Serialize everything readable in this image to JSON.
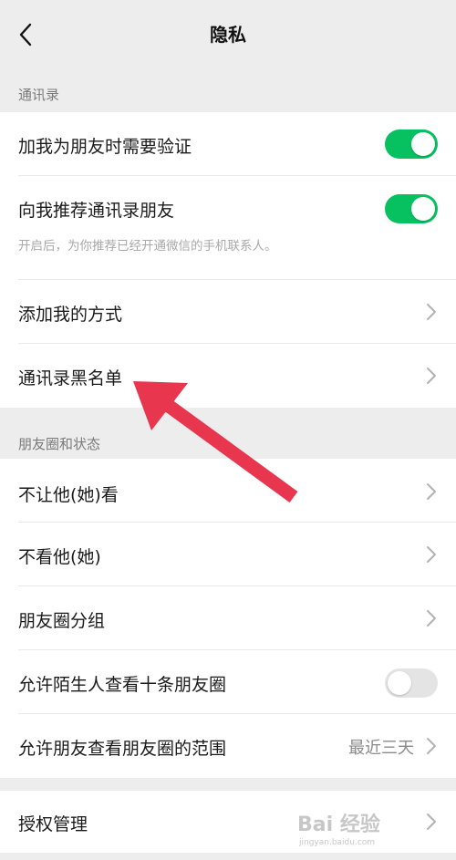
{
  "header": {
    "title": "隐私",
    "back_icon": "chevron-left-icon"
  },
  "contacts_section": {
    "label": "通讯录",
    "items": [
      {
        "label": "加我为朋友时需要验证",
        "control": "toggle",
        "on": true
      },
      {
        "label": "向我推荐通讯录朋友",
        "subtext": "开启后，为你推荐已经开通微信的手机联系人。",
        "control": "toggle",
        "on": true
      },
      {
        "label": "添加我的方式",
        "control": "chevron"
      },
      {
        "label": "通讯录黑名单",
        "control": "chevron"
      }
    ]
  },
  "moments_section": {
    "label": "朋友圈和状态",
    "items": [
      {
        "label": "不让他(她)看",
        "control": "chevron"
      },
      {
        "label": "不看他(她)",
        "control": "chevron"
      },
      {
        "label": "朋友圈分组",
        "control": "chevron"
      },
      {
        "label": "允许陌生人查看十条朋友圈",
        "control": "toggle",
        "on": false
      },
      {
        "label": "允许朋友查看朋友圈的范围",
        "value": "最近三天",
        "control": "chevron"
      }
    ]
  },
  "auth_section": {
    "items": [
      {
        "label": "授权管理",
        "control": "chevron"
      }
    ]
  },
  "colors": {
    "toggle_on": "#07c160",
    "toggle_off": "#e4e4e4",
    "annotation_arrow": "#e8364f",
    "background": "#ededed"
  },
  "watermark": {
    "text": "Bai 经验",
    "subtext": "jingyan.baidu.com"
  }
}
